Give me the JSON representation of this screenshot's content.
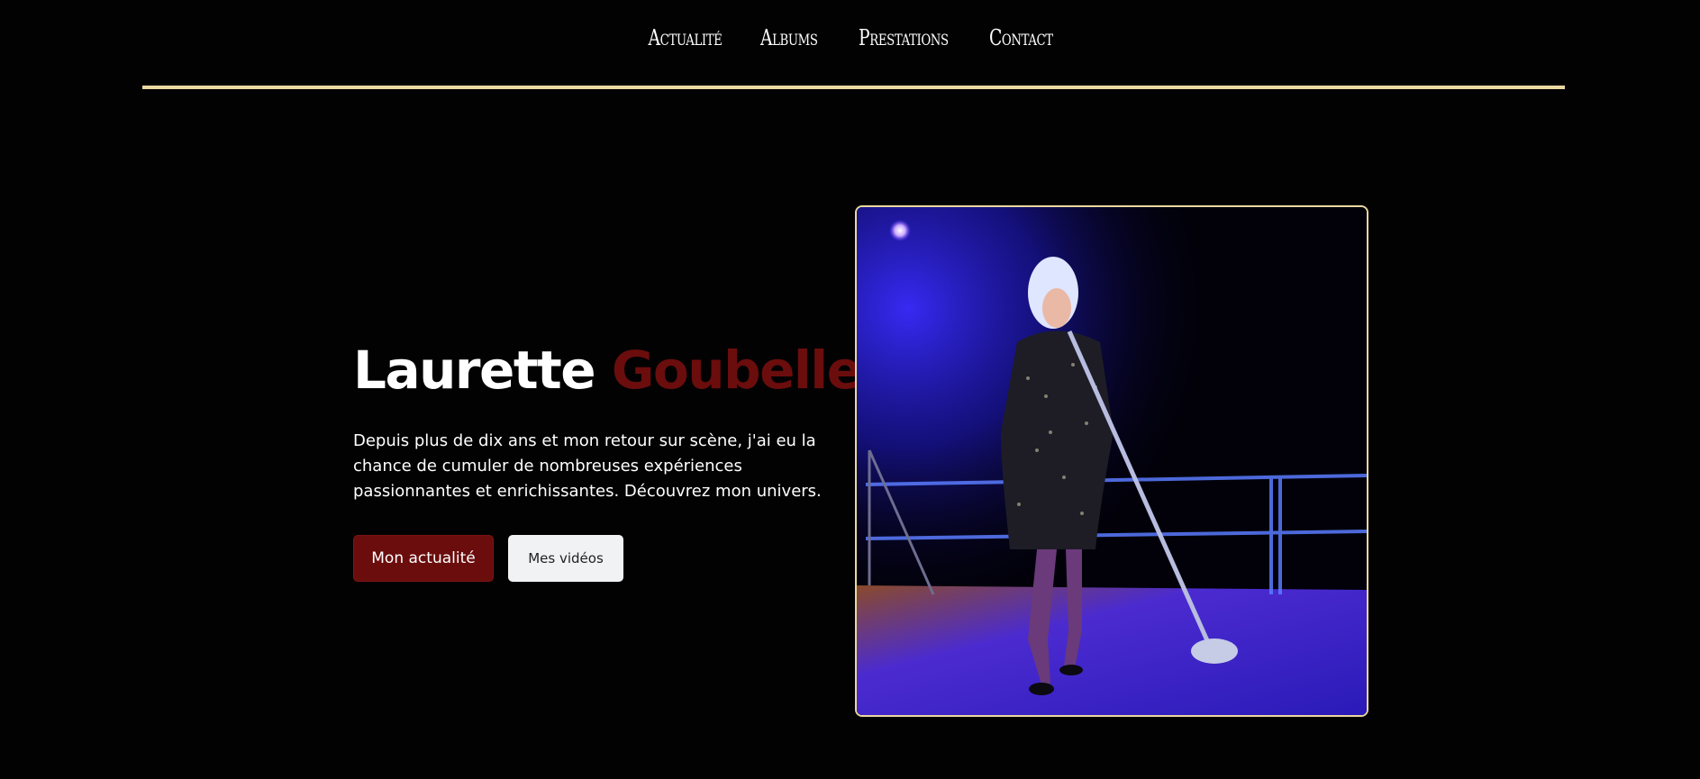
{
  "nav": {
    "items": [
      "Actualité",
      "Albums",
      "Prestations",
      "Contact"
    ]
  },
  "hero": {
    "title_first": "Laurette",
    "title_last": "Goubelle",
    "description": "Depuis plus de dix ans et mon retour sur scène, j'ai eu la chance de cumuler de nombreuses expériences passionnantes et enrichissantes. Découvrez mon univers.",
    "primary_button": "Mon actualité",
    "secondary_button": "Mes vidéos"
  },
  "colors": {
    "background": "#030203",
    "accent_gold": "#ead8a0",
    "brand_red": "#6b0d0d"
  }
}
